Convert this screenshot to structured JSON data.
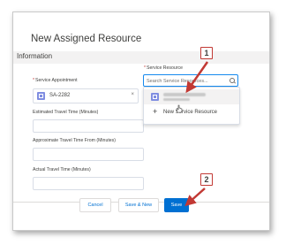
{
  "modal": {
    "title": "New Assigned Resource",
    "section": "Information"
  },
  "fields": {
    "service_appointment": {
      "required_mark": "*",
      "label": "Service Appointment",
      "value": "SA-2282",
      "remove_glyph": "×"
    },
    "service_resource": {
      "required_mark": "*",
      "label": "Service Resource",
      "placeholder": "Search Service Resources..."
    },
    "estimated_travel_time": {
      "label": "Estimated Travel Time (Minutes)",
      "value": ""
    },
    "approximate_travel_time_from": {
      "label": "Approximate Travel Time From (Minutes)",
      "value": ""
    },
    "actual_travel_time": {
      "label": "Actual Travel Time (Minutes)",
      "value": ""
    }
  },
  "dropdown": {
    "result_icon": "resource-icon",
    "new_item": {
      "icon": "plus-icon",
      "glyph": "+",
      "label": "New Service Resource"
    }
  },
  "footer": {
    "cancel_label": "Cancel",
    "save_new_label": "Save & New",
    "save_label": "Save"
  },
  "callouts": [
    {
      "number": "1"
    },
    {
      "number": "2"
    }
  ],
  "colors": {
    "brand": "#0070d2",
    "focus_border": "#1589ee",
    "callout_arrow": "#c23934",
    "record_icon": "#7f8de1",
    "section_background": "#f3f2f2"
  }
}
